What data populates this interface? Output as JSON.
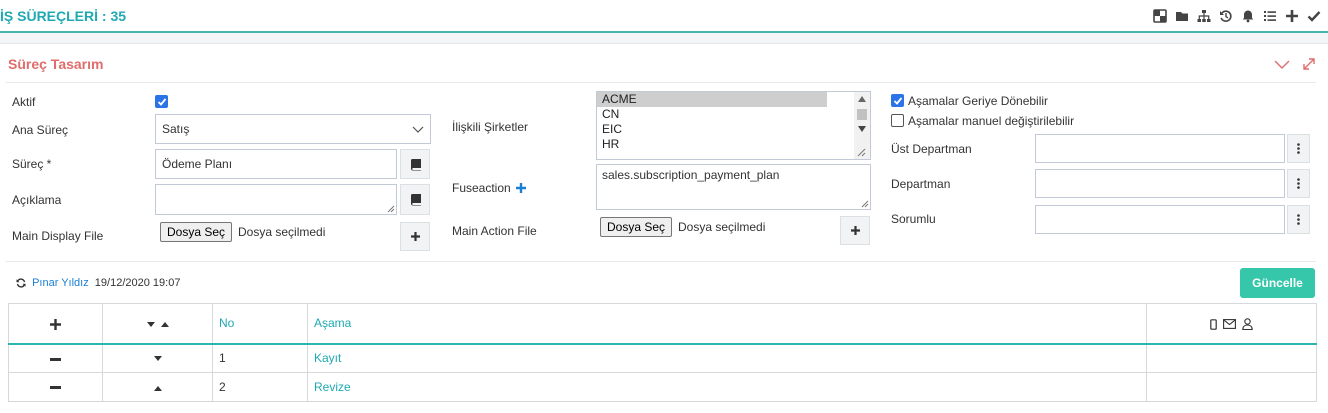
{
  "header": {
    "title": "İŞ SÜREÇLERİ : 35"
  },
  "top_icons": [
    "layout-icon",
    "folder-icon",
    "sitemap-icon",
    "history-icon",
    "bell-icon",
    "list-icon",
    "plus-icon",
    "check-icon"
  ],
  "panel": {
    "title": "Süreç Tasarım"
  },
  "form": {
    "aktif_label": "Aktif",
    "aktif_checked": true,
    "ana_surec_label": "Ana Süreç",
    "ana_surec_value": "Satış",
    "surec_label": "Süreç *",
    "surec_value": "Ödeme Planı",
    "aciklama_label": "Açıklama",
    "aciklama_value": "",
    "main_display_label": "Main Display File",
    "file_button": "Dosya Seç",
    "file_none": "Dosya seçilmedi",
    "iliskili_label": "İlişkili Şirketler",
    "companies": [
      "ACME",
      "CN",
      "EIC",
      "HR"
    ],
    "companies_selected": "ACME",
    "fuseaction_label": "Fuseaction",
    "fuseaction_value": "sales.subscription_payment_plan",
    "main_action_label": "Main Action File",
    "geri_label": "Aşamalar Geriye Dönebilir",
    "geri_checked": true,
    "manuel_label": "Aşamalar manuel değiştirilebilir",
    "manuel_checked": false,
    "ust_dept_label": "Üst Departman",
    "dept_label": "Departman",
    "sorumlu_label": "Sorumlu"
  },
  "record": {
    "user": "Pınar Yıldız",
    "date": "19/12/2020 19:07"
  },
  "update_button": "Güncelle",
  "table": {
    "headers": {
      "no": "No",
      "asama": "Aşama"
    },
    "rows": [
      {
        "no": "1",
        "asama": "Kayıt",
        "arrow": "down"
      },
      {
        "no": "2",
        "asama": "Revize",
        "arrow": "up"
      }
    ]
  },
  "colors": {
    "accent": "#1fa9b2",
    "panel_title": "#e06c6c",
    "button": "#36c6a9"
  }
}
